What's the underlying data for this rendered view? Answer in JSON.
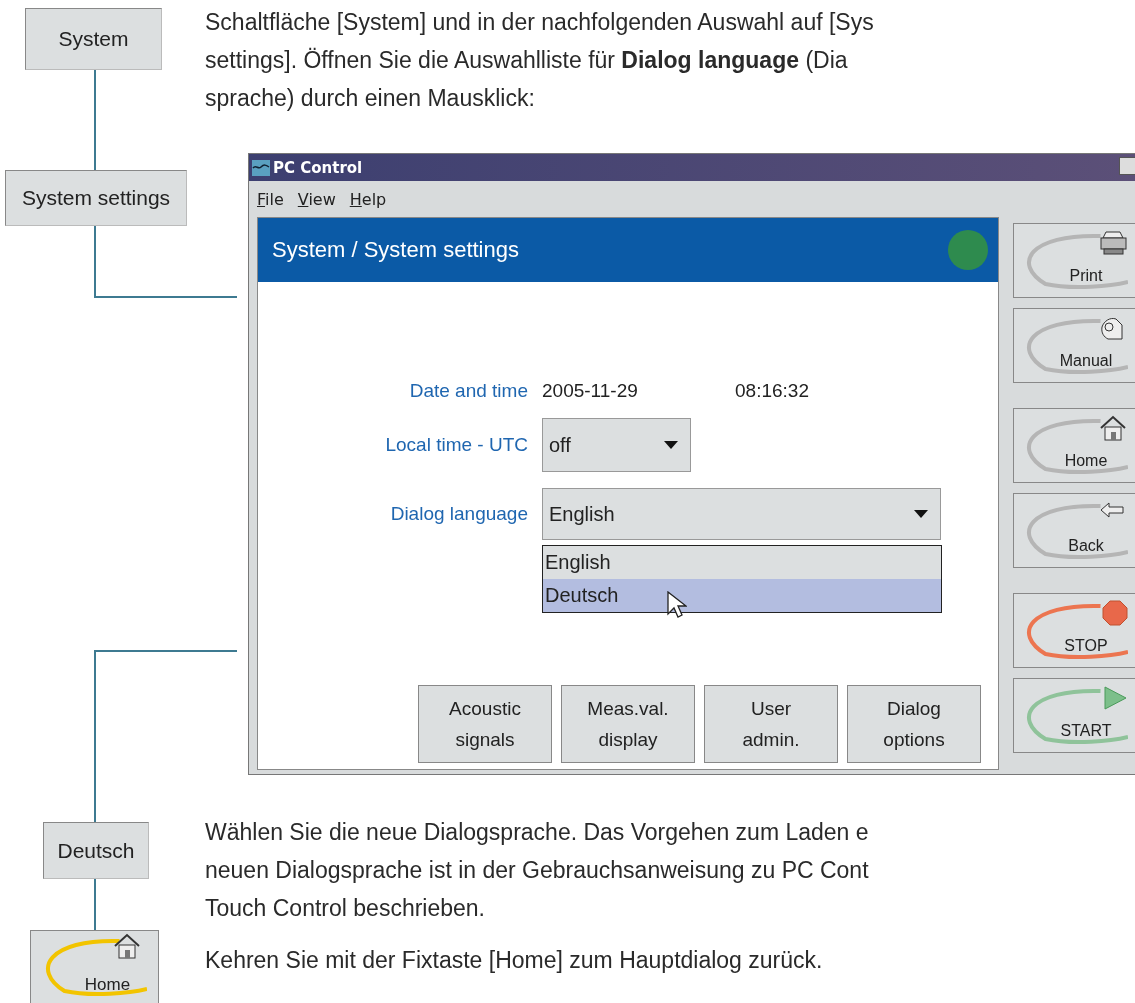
{
  "intro": {
    "lines": [
      "Schaltfläche [System] und in der nachfolgenden Auswahl auf [Sys",
      "settings]. Öffnen Sie die Auswahlliste für **Dialog language** (Dia",
      "sprache) durch einen Mausklick:"
    ]
  },
  "flow": [
    {
      "kind": "key",
      "label": "System"
    },
    {
      "kind": "key",
      "label": "System settings"
    },
    {
      "kind": "key",
      "label": "Deutsch"
    },
    {
      "kind": "home",
      "label": "Home"
    }
  ],
  "window": {
    "title": "PC Control",
    "menu": [
      {
        "label": "File"
      },
      {
        "label": "View"
      },
      {
        "label": "Help"
      }
    ],
    "header": {
      "title": "System / System settings"
    },
    "fields": [
      {
        "kind": "text",
        "label": "Date and time",
        "values": [
          "2005-11-29",
          "08:16:32"
        ]
      },
      {
        "kind": "select",
        "label": "Local time - UTC",
        "value": "off",
        "expanded": false
      },
      {
        "kind": "select",
        "label": "Dialog language",
        "value": "English",
        "expanded": true,
        "options": [
          {
            "label": "English",
            "highlighted": false
          },
          {
            "label": "Deutsch",
            "highlighted": true
          }
        ]
      }
    ],
    "buttons": [
      "Acoustic\nsignals",
      "Meas.val.\ndisplay",
      "User\nadmin.",
      "Dialog\noptions"
    ],
    "side_buttons": [
      {
        "kind": "print",
        "label": "Print"
      },
      {
        "kind": "manual",
        "label": "Manual"
      },
      {
        "kind": "home",
        "label": "Home"
      },
      {
        "kind": "back",
        "label": "Back"
      },
      {
        "kind": "stop",
        "label": "STOP"
      },
      {
        "kind": "start",
        "label": "START"
      }
    ]
  },
  "paragraphs": [
    {
      "lines": [
        "Wählen Sie die neue Dialogsprache. Das Vorgehen zum Laden e",
        "neuen Dialogsprache ist in der Gebrauchsanweisung zu PC Cont",
        "Touch Control beschrieben."
      ]
    },
    {
      "lines": [
        "Kehren Sie mit der Fixtaste [Home] zum Hauptdialog zurück."
      ]
    }
  ]
}
